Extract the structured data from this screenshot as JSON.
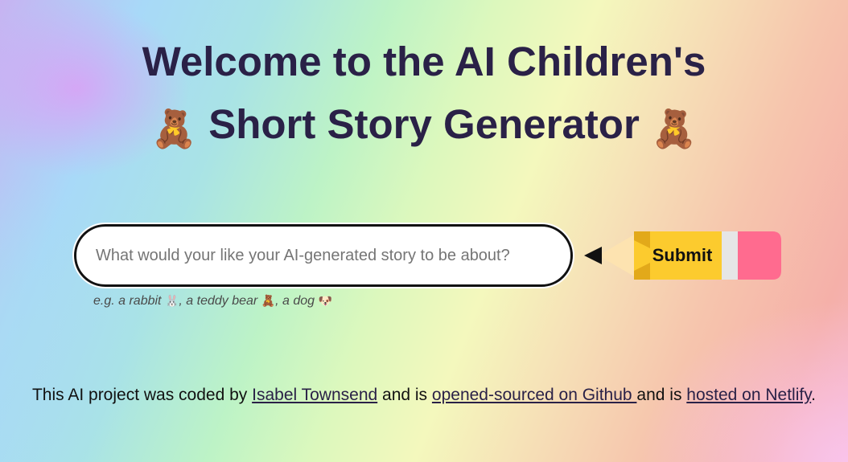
{
  "header": {
    "title_line1": "Welcome to the AI Children's",
    "title_emoji_left": "🧸",
    "title_line2": "Short Story Generator",
    "title_emoji_right": "🧸"
  },
  "form": {
    "input_placeholder": "What would your like your AI-generated story to be about?",
    "input_value": "",
    "submit_label": "Submit"
  },
  "hint": {
    "prefix": "e.g. a rabbit",
    "rabbit_emoji": "🐰",
    "middle": ", a teddy bear",
    "bear_emoji": "🧸",
    "suffix": ", a dog",
    "dog_emoji": "🐶"
  },
  "footer": {
    "text1": "This AI project was coded by ",
    "author_link": "Isabel Townsend",
    "text2": " and is ",
    "github_link": "opened-sourced on Github ",
    "text3": "and is ",
    "netlify_link": "hosted on Netlify",
    "text4": "."
  },
  "colors": {
    "title_text": "#2a2147",
    "pencil_body": "#fccb2e",
    "pencil_eraser": "#ff6b8f",
    "pencil_ferrule": "#e6e6e6",
    "pencil_wood": "#fde3b0",
    "pencil_tip": "#111111"
  },
  "icons": {
    "title_left": "teddy-bear-icon",
    "title_right": "teddy-bear-icon",
    "submit": "pencil-icon"
  }
}
